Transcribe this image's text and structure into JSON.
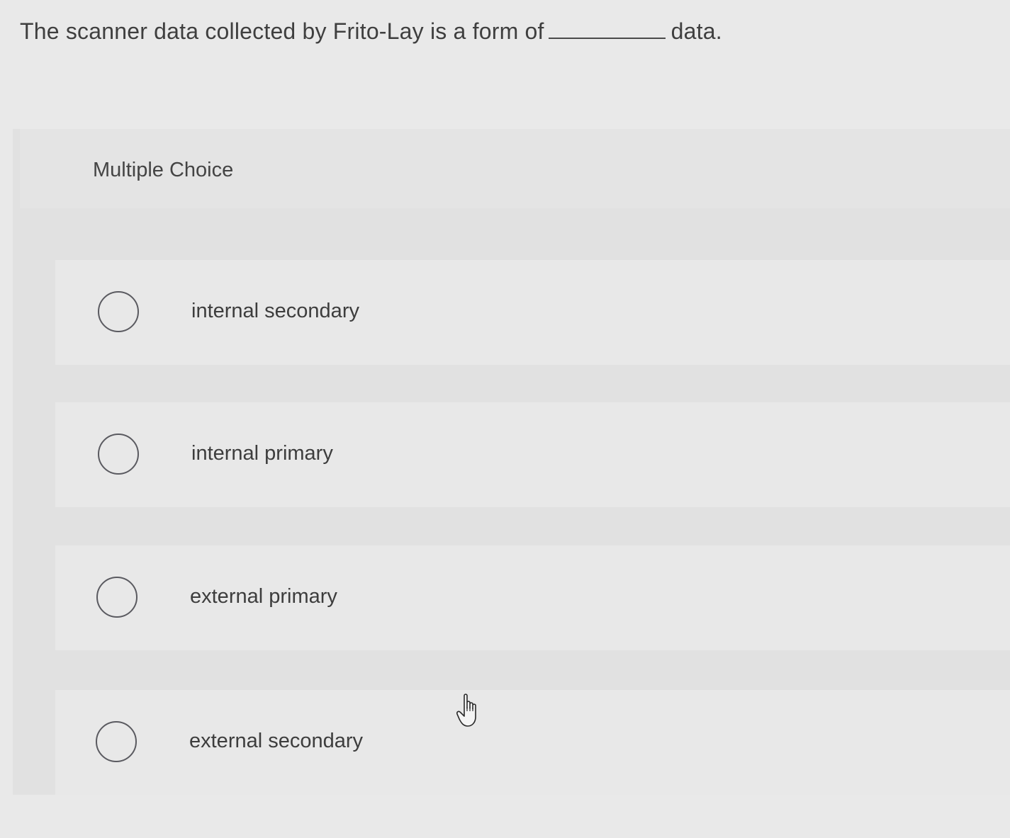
{
  "question": {
    "text_before": "The scanner data collected by Frito-Lay is a form of",
    "text_after": "data."
  },
  "panel": {
    "label": "Multiple Choice"
  },
  "options": [
    {
      "label": "internal secondary"
    },
    {
      "label": "internal primary"
    },
    {
      "label": "external primary"
    },
    {
      "label": "external secondary"
    }
  ],
  "cursor": {
    "icon": "hand-pointer-icon"
  }
}
